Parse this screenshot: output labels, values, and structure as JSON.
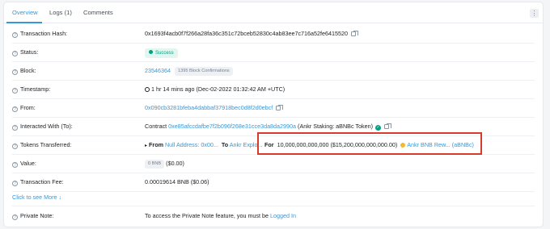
{
  "tabs": [
    {
      "label": "Overview"
    },
    {
      "label": "Logs (1)"
    },
    {
      "label": "Comments"
    }
  ],
  "more_menu": "⋮",
  "rows": {
    "tx_hash": {
      "label": "Transaction Hash:",
      "value": "0x1693f4acb0f7f266a28fa36c351c72bceb52830c4ab83ee7c716a52fe6415520"
    },
    "status": {
      "label": "Status:",
      "value": "Success"
    },
    "block": {
      "label": "Block:",
      "number": "23546364",
      "confirmations": "1395 Block Confirmations"
    },
    "timestamp": {
      "label": "Timestamp:",
      "value": "1 hr 14 mins ago (Dec-02-2022 01:32:42 AM +UTC)"
    },
    "from": {
      "label": "From:",
      "value": "0x090cb3281bfeba4dabbaf37918bec0d8f2d0ebcf"
    },
    "interacted": {
      "label": "Interacted With (To):",
      "prefix": "Contract",
      "address": "0xe85afccdafbe7f2b096f268e31cce3da8da2990a",
      "name": "(Ankr Staking: aBNBc Token)"
    },
    "tokens": {
      "label": "Tokens Transferred:",
      "from_label": "From",
      "from_value": "Null Address: 0x00...",
      "to_label": "To",
      "to_value": "Ankr Explo...",
      "for_label": "For",
      "amount": "10,000,000,000,000 ($15,200,000,000,000.00)",
      "token": "Ankr BNB Rew... (aBNBc)"
    },
    "value": {
      "label": "Value:",
      "badge": "0 BNB",
      "usd": "($0.00)"
    },
    "fee": {
      "label": "Transaction Fee:",
      "value": "0.00019614 BNB ($0.06)"
    },
    "click_more": "Click to see More",
    "note": {
      "label": "Private Note:",
      "text": "To access the Private Note feature, you must be",
      "link": "Logged In"
    }
  },
  "colors": {
    "accent": "#3498db",
    "success": "#00a186",
    "highlight_box": "#d93b2b"
  }
}
